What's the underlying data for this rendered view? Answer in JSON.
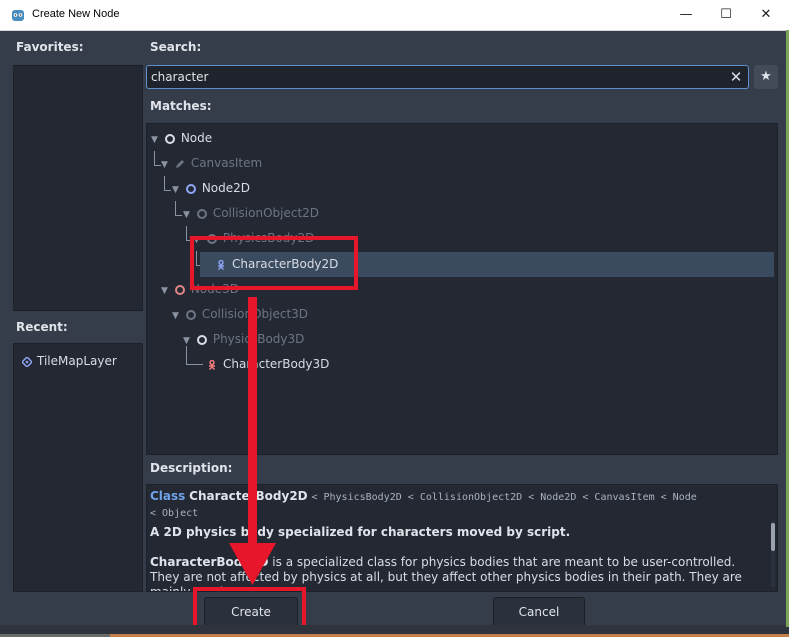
{
  "window": {
    "title": "Create New Node",
    "controls": {
      "minimize": "—",
      "maximize": "☐",
      "close": "✕"
    }
  },
  "favorites": {
    "label": "Favorites:"
  },
  "recent": {
    "label": "Recent:",
    "items": [
      {
        "label": "TileMapLayer",
        "icon": "tilemap-icon"
      }
    ]
  },
  "search": {
    "label": "Search:",
    "value": "character",
    "clear_icon": "✕",
    "favorite_icon": "★"
  },
  "matches": {
    "label": "Matches:",
    "tree": [
      {
        "label": "Node",
        "icon": "circle",
        "dim": false
      },
      {
        "label": "CanvasItem",
        "icon": "pencil",
        "dim": true
      },
      {
        "label": "Node2D",
        "icon": "circle-blue",
        "dim": false
      },
      {
        "label": "CollisionObject2D",
        "icon": "circle",
        "dim": true
      },
      {
        "label": "PhysicsBody2D",
        "icon": "circle",
        "dim": true
      },
      {
        "label": "CharacterBody2D",
        "icon": "character-2d",
        "dim": false,
        "selected": true
      },
      {
        "label": "Node3D",
        "icon": "circle-red",
        "dim": true
      },
      {
        "label": "CollisionObject3D",
        "icon": "circle",
        "dim": true
      },
      {
        "label": "PhysicsBody3D",
        "icon": "circle",
        "dim": true
      },
      {
        "label": "CharacterBody3D",
        "icon": "character-3d",
        "dim": false
      }
    ]
  },
  "description": {
    "label": "Description:",
    "class_keyword": "Class",
    "class_name": "CharacterBody2D",
    "inheritance": "< PhysicsBody2D < CollisionObject2D < Node2D < CanvasItem < Node",
    "inheritance_cont": "< Object",
    "summary": "A 2D physics body specialized for characters moved by script.",
    "body_name": "CharacterBody2D",
    "body_text": " is a specialized class for physics bodies that are meant to be user-controlled. They are not affected by physics at all, but they affect other physics bodies in their path. They are mainly used to"
  },
  "buttons": {
    "create": "Create",
    "cancel": "Cancel"
  },
  "colors": {
    "highlight": "#e8162b",
    "accent": "#5f8fce",
    "selected_row": "#3a4a5f"
  }
}
